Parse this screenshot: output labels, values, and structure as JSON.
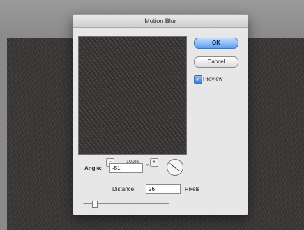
{
  "dialog": {
    "title": "Motion Blur",
    "ok_label": "OK",
    "cancel_label": "Cancel",
    "preview_label": "Preview",
    "preview_checked": true,
    "zoom": {
      "minus_icon": "minus-icon",
      "value": "100%",
      "plus_icon": "plus-icon"
    },
    "angle": {
      "label": "Angle:",
      "value": "-51",
      "unit": "°",
      "dial_icon": "angle-dial-icon"
    },
    "distance": {
      "label": "Distance:",
      "value": "26",
      "unit": "Pixels",
      "slider_value": 26
    }
  }
}
